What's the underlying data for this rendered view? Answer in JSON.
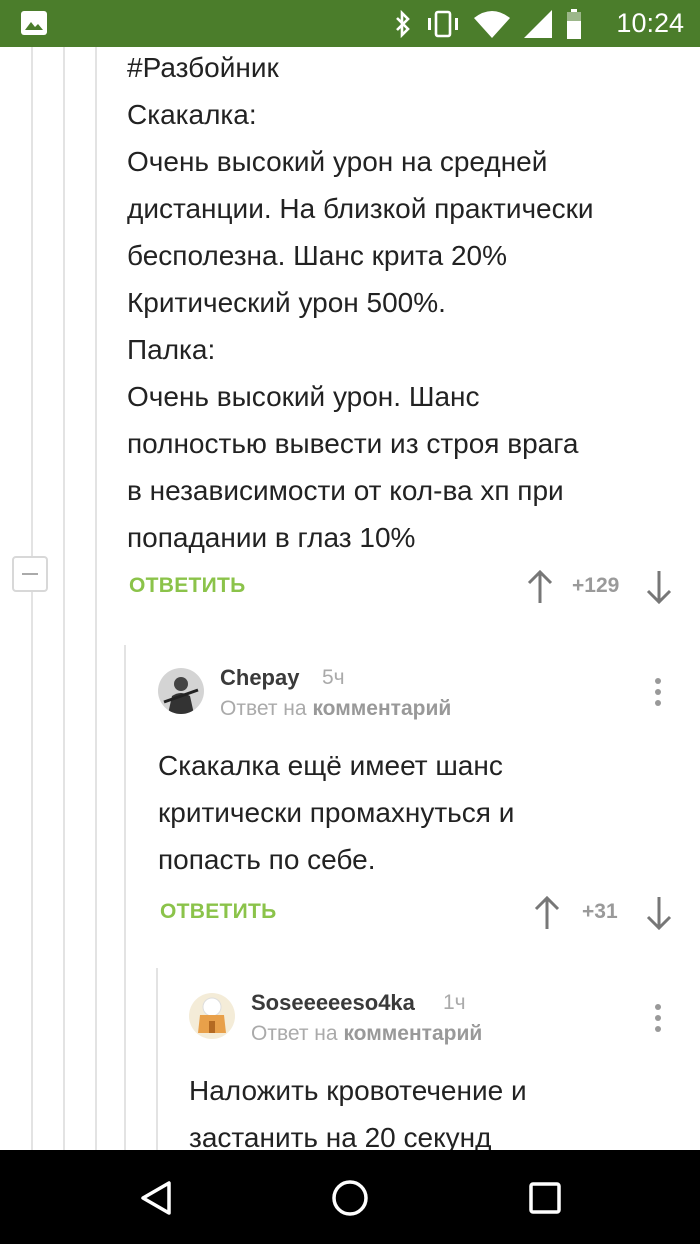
{
  "status_bar": {
    "time": "10:24",
    "icons": [
      "image-notification-icon",
      "bluetooth-icon",
      "vibrate-icon",
      "wifi-icon",
      "cell-signal-icon",
      "battery-icon"
    ]
  },
  "comments": [
    {
      "text_lines": [
        "#Разбойник",
        "Скакалка:",
        "Очень высокий урон на средней",
        "дистанции. На близкой практически",
        "бесполезна. Шанс крита 20%",
        "Критический урон 500%.",
        "Палка:",
        "Очень высокий урон. Шанс",
        "полностью вывести из строя врага",
        "в независимости от кол-ва хп при",
        "попадании в глаз 10%"
      ],
      "reply_label": "ОТВЕТИТЬ",
      "score": "+129"
    },
    {
      "author": "Chepay",
      "time": "5ч",
      "reply_prefix": "Ответ на",
      "reply_target": "комментарий",
      "text_lines": [
        "Скакалка ещё имеет шанс",
        "критически промахнуться и",
        "попасть по себе."
      ],
      "reply_label": "ОТВЕТИТЬ",
      "score": "+31"
    },
    {
      "author": "Soseeeeeso4ka",
      "time": "1ч",
      "reply_prefix": "Ответ на",
      "reply_target": "комментарий",
      "text_lines": [
        "Наложить кровотечение и",
        "застанить на 20 секунд"
      ]
    }
  ],
  "nav_bar": {
    "buttons": [
      "back-icon",
      "home-icon",
      "recents-icon"
    ]
  },
  "colors": {
    "status_bar": "#4b7d2b",
    "accent": "#8bc34a",
    "muted": "#9a9a9a"
  }
}
